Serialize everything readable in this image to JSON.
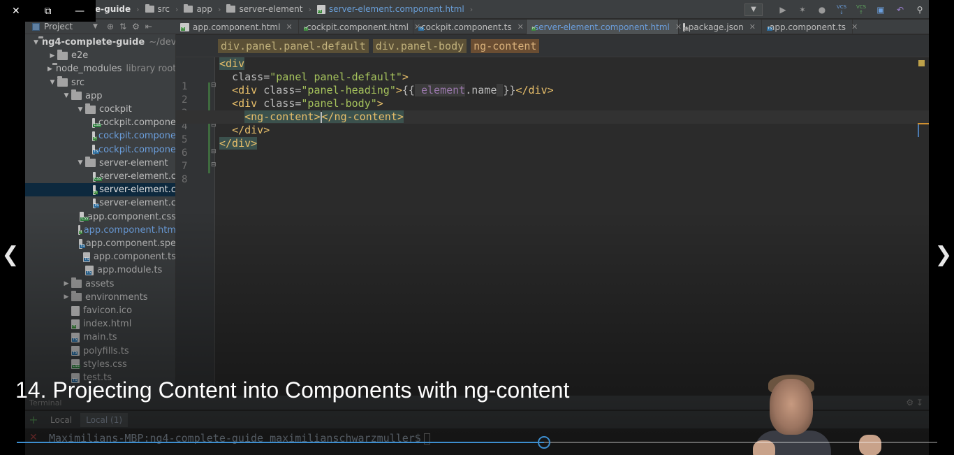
{
  "breadcrumbs": [
    {
      "label": "e-guide",
      "type": "project",
      "bold": true
    },
    {
      "label": "src",
      "type": "folder"
    },
    {
      "label": "app",
      "type": "folder"
    },
    {
      "label": "server-element",
      "type": "folder"
    },
    {
      "label": "server-element.component.html",
      "type": "html-file",
      "active": true
    }
  ],
  "project_panel": {
    "title": "Project",
    "tree": [
      {
        "label": "ng4-complete-guide",
        "suffix": "~/deve",
        "depth": 0,
        "arrow": "down",
        "icon": "folder",
        "style": "bold"
      },
      {
        "label": "e2e",
        "depth": 1,
        "arrow": "right",
        "icon": "folder"
      },
      {
        "label": "node_modules",
        "suffix": "library root",
        "depth": 1,
        "arrow": "right",
        "icon": "folder"
      },
      {
        "label": "src",
        "depth": 1,
        "arrow": "down",
        "icon": "folder"
      },
      {
        "label": "app",
        "depth": 2,
        "arrow": "down",
        "icon": "folder"
      },
      {
        "label": "cockpit",
        "depth": 3,
        "arrow": "down",
        "icon": "folder"
      },
      {
        "label": "cockpit.compone",
        "depth": 4,
        "icon": "css"
      },
      {
        "label": "cockpit.compone",
        "depth": 4,
        "icon": "html",
        "style": "blue"
      },
      {
        "label": "cockpit.compone",
        "depth": 4,
        "icon": "ts",
        "style": "blue"
      },
      {
        "label": "server-element",
        "depth": 3,
        "arrow": "down",
        "icon": "folder"
      },
      {
        "label": "server-element.c",
        "depth": 4,
        "icon": "css"
      },
      {
        "label": "server-element.c",
        "depth": 4,
        "icon": "html",
        "style": "white",
        "selected": true
      },
      {
        "label": "server-element.c",
        "depth": 4,
        "icon": "ts"
      },
      {
        "label": "app.component.css",
        "depth": 3,
        "icon": "css"
      },
      {
        "label": "app.component.htm",
        "depth": 3,
        "icon": "html",
        "style": "blue"
      },
      {
        "label": "app.component.spe",
        "depth": 3,
        "icon": "ts"
      },
      {
        "label": "app.component.ts",
        "depth": 3,
        "icon": "ts"
      },
      {
        "label": "app.module.ts",
        "depth": 3,
        "icon": "ts"
      },
      {
        "label": "assets",
        "depth": 2,
        "arrow": "right",
        "icon": "folder"
      },
      {
        "label": "environments",
        "depth": 2,
        "arrow": "right",
        "icon": "folder"
      },
      {
        "label": "favicon.ico",
        "depth": 2,
        "icon": "ico"
      },
      {
        "label": "index.html",
        "depth": 2,
        "icon": "html"
      },
      {
        "label": "main.ts",
        "depth": 2,
        "icon": "ts"
      },
      {
        "label": "polyfills.ts",
        "depth": 2,
        "icon": "ts"
      },
      {
        "label": "styles.css",
        "depth": 2,
        "icon": "css"
      },
      {
        "label": "test.ts",
        "depth": 2,
        "icon": "ts"
      }
    ]
  },
  "tabs": [
    {
      "label": "app.component.html",
      "icon": "html"
    },
    {
      "label": "cockpit.component.html",
      "icon": "html"
    },
    {
      "label": "cockpit.component.ts",
      "icon": "ts"
    },
    {
      "label": "server-element.component.html",
      "icon": "html",
      "active": true
    },
    {
      "label": "package.json",
      "icon": "json"
    },
    {
      "label": "app.component.ts",
      "icon": "ts"
    }
  ],
  "tag_path": [
    "div.panel.panel-default",
    "div.panel-body",
    "ng-content"
  ],
  "line_numbers": [
    "1",
    "2",
    "3",
    "4",
    "5",
    "6",
    "7",
    "8"
  ],
  "terminal": {
    "title": "Terminal",
    "tabs": [
      "Local",
      "Local (1)"
    ],
    "prompt": "Maximilians-MBP:ng4-complete-guide maximilianschwarzmuller$"
  },
  "video": {
    "title": "14. Projecting Content into Components with ng-content",
    "progress_fraction": 0.573
  },
  "colors": {
    "accent": "#3d8ecf",
    "link_file": "#6b9edc",
    "tag": "#e8bf6a",
    "string": "#a5c25c"
  }
}
